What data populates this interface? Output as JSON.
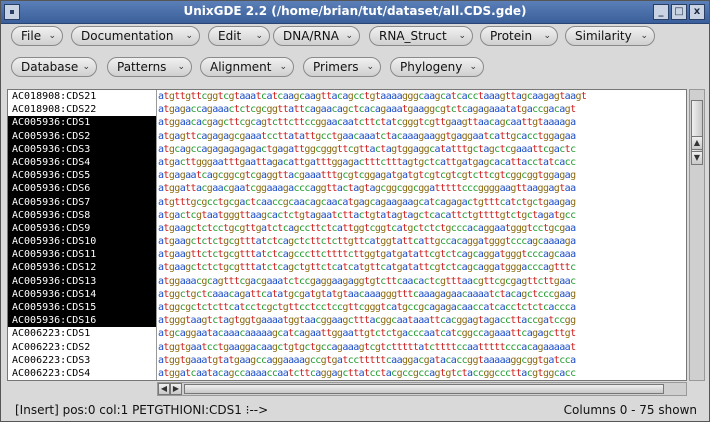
{
  "window": {
    "title": "UnixGDE 2.2 (/home/brian/tut/dataset/all.CDS.gde)"
  },
  "titlebar_buttons": [
    "_",
    "□",
    "x"
  ],
  "menus_row1": [
    "File",
    "Documentation",
    "Edit",
    "DNA/RNA",
    "RNA_Struct",
    "Protein",
    "Similarity"
  ],
  "menus_row2": [
    "Database",
    "Patterns",
    "Alignment",
    "Primers",
    "Phylogeny"
  ],
  "menu_arrow": "⌄",
  "sequences": [
    {
      "name": "AC018908:CDS21",
      "seq": "atgttgttcggtcgtaaatcatcaagcaagttacagcctgtaaaagggcaagcatcacctaaagttagcaagagtaagt",
      "selected": false
    },
    {
      "name": "AC018908:CDS22",
      "seq": "atgagaccagaaactctcgcggttattcagaacagctcacagaaatgaaggcgtctcagagaaatatgaccgacagt",
      "selected": false
    },
    {
      "name": "AC005936:CDS1",
      "seq": "atggaacacgagcttcgcagtcttcttccggaacaatcttctatcgggtcgttgaagttaacagcaattgtaaaaga",
      "selected": true
    },
    {
      "name": "AC005936:CDS2",
      "seq": "atgagttcagagagcgaaatccttatattgcctgaacaaatctacaaagaaggtgaggaatcattgcacctggagaa",
      "selected": true
    },
    {
      "name": "AC005936:CDS3",
      "seq": "atgcagccagagagagagactgagattggcgggttcgttactagtggaggcatatttgctagctcgaaattcgactc",
      "selected": true
    },
    {
      "name": "AC005936:CDS4",
      "seq": "atgacttgggaatttgaattagacattgatttggagactttctttagtgctcattgatgagcacattacctatcacc",
      "selected": true
    },
    {
      "name": "AC005936:CDS5",
      "seq": "atgagaatcagcggcgtcgaggttacgaaatttgcgtcggagatgatgtcgtcgtcgtcttcgtcggcggtggagag",
      "selected": true
    },
    {
      "name": "AC005936:CDS6",
      "seq": "atggattacgaacgaatcggaaagacccaggttactagtagcggcggcggatttttcccggggaagttaaggagtaa",
      "selected": true
    },
    {
      "name": "AC005936:CDS7",
      "seq": "atgtttgcgcctgcgactcaaccgcaacagcaacatgagcagaagaagcatcagagactgtttcatctgctgaagag",
      "selected": true
    },
    {
      "name": "AC005936:CDS8",
      "seq": "atgactcgtaatgggttaagcactctgtagaatcttactgtatagtagctcacattctgttttgtctgctagatgcc",
      "selected": true
    },
    {
      "name": "AC005936:CDS9",
      "seq": "atgaagctctcctgcgttgatctcagccttctcattggtcggtcatgctctctgcccacaggaatgggtcctgcgaa",
      "selected": true
    },
    {
      "name": "AC005936:CDS10",
      "seq": "atgaagctctctgcgtttatctcagctcttctcttgttcatggtattcattgccacaggatgggtcccagcaaaaga",
      "selected": true
    },
    {
      "name": "AC005936:CDS11",
      "seq": "atgaagttctctgcgtttatctcagcccttcttttcttggtgatgatattcgtctcagcaggatgggtcccagcaaa",
      "selected": true
    },
    {
      "name": "AC005936:CDS12",
      "seq": "atgaagctctctgcgtttatctcagctgttctcatcatgttcatgatattcgtctcagcaggatgggacccagtttc",
      "selected": true
    },
    {
      "name": "AC005936:CDS13",
      "seq": "atggaaacgcagtttcgacgaaatctccgaggaagaggtgtcttcaacactcgtttaacgttcgcgagttcttgaac",
      "selected": true
    },
    {
      "name": "AC005936:CDS14",
      "seq": "atggctgctcaaacagattcatatgcgatgtatgtaacaaagggtttcaaagagaacaaaatctacagctcccgaag",
      "selected": true
    },
    {
      "name": "AC005936:CDS15",
      "seq": "atggcgctctcttcatcctcgctgttcctcctccgttcgggtcatgccgcagagacaaccatcacctctctcaccca",
      "selected": true
    },
    {
      "name": "AC005936:CDS16",
      "seq": "atgggtaagtctagtggtgaaaatggtaacggaagctttacggcaataaattcacggagtagaccttaccgatccgg",
      "selected": true
    },
    {
      "name": "AC006223:CDS1",
      "seq": "atgcaggaatacaaacaaaaagcatcagaattggaattgtctctgacccaatcatcggccagaaattcagagcttgt",
      "selected": false
    },
    {
      "name": "AC006223:CDS2",
      "seq": "atggtgaatcctgaaggacaagctgtgctgccagaaagtcgtctttttatcttttccaatttttcccacagaaaaat",
      "selected": false
    },
    {
      "name": "AC006223:CDS3",
      "seq": "atggtgaaatgtatgaagccaggaaaagccgtgatcctttttcaaggacgatacaccggtaaaaaggcggtgatcca",
      "selected": false
    },
    {
      "name": "AC006223:CDS4",
      "seq": "atggatcaatacagccaaaaccaatcttcaggagcttatcctacgccgccagtgtctaccggcccttacgtggcacc",
      "selected": false
    }
  ],
  "status": {
    "left": "[Insert] pos:0 col:1    PETGTHIONI:CDS1 ⁝-->",
    "right": "Columns 0 - 75 shown"
  },
  "colors": {
    "a": "#1a4cc8",
    "c": "#1d9a2a",
    "g": "#8a6a10",
    "t": "#cc1d1d",
    "title_bg": "#4a6fa8"
  }
}
